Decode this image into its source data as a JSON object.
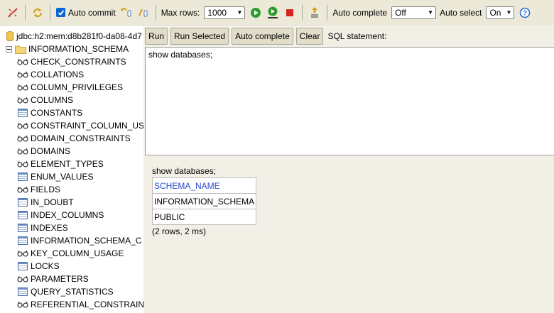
{
  "toolbar": {
    "auto_commit_label": "Auto commit",
    "max_rows_label": "Max rows:",
    "max_rows_value": "1000",
    "auto_complete_label": "Auto complete",
    "auto_complete_value": "Off",
    "auto_select_label": "Auto select",
    "auto_select_value": "On"
  },
  "tree": {
    "connection": "jdbc:h2:mem:d8b281f0-da08-4d7",
    "schema": "INFORMATION_SCHEMA",
    "items": [
      {
        "label": "CHECK_CONSTRAINTS",
        "icon": "view-icon"
      },
      {
        "label": "COLLATIONS",
        "icon": "view-icon"
      },
      {
        "label": "COLUMN_PRIVILEGES",
        "icon": "view-icon"
      },
      {
        "label": "COLUMNS",
        "icon": "view-icon"
      },
      {
        "label": "CONSTANTS",
        "icon": "table-icon"
      },
      {
        "label": "CONSTRAINT_COLUMN_US",
        "icon": "view-icon"
      },
      {
        "label": "DOMAIN_CONSTRAINTS",
        "icon": "view-icon"
      },
      {
        "label": "DOMAINS",
        "icon": "view-icon"
      },
      {
        "label": "ELEMENT_TYPES",
        "icon": "view-icon"
      },
      {
        "label": "ENUM_VALUES",
        "icon": "table-icon"
      },
      {
        "label": "FIELDS",
        "icon": "view-icon"
      },
      {
        "label": "IN_DOUBT",
        "icon": "table-icon"
      },
      {
        "label": "INDEX_COLUMNS",
        "icon": "table-icon"
      },
      {
        "label": "INDEXES",
        "icon": "table-icon"
      },
      {
        "label": "INFORMATION_SCHEMA_C",
        "icon": "table-icon"
      },
      {
        "label": "KEY_COLUMN_USAGE",
        "icon": "view-icon"
      },
      {
        "label": "LOCKS",
        "icon": "table-icon"
      },
      {
        "label": "PARAMETERS",
        "icon": "view-icon"
      },
      {
        "label": "QUERY_STATISTICS",
        "icon": "table-icon"
      },
      {
        "label": "REFERENTIAL_CONSTRAIN",
        "icon": "view-icon"
      }
    ]
  },
  "buttons": {
    "run": "Run",
    "run_selected": "Run Selected",
    "auto_complete": "Auto complete",
    "clear": "Clear",
    "sql_label": "SQL statement:"
  },
  "editor": {
    "text": "show databases;"
  },
  "result": {
    "echo": "show databases;",
    "column": "SCHEMA_NAME",
    "rows": [
      "INFORMATION_SCHEMA",
      "PUBLIC"
    ],
    "info": "(2 rows, 2 ms)"
  }
}
